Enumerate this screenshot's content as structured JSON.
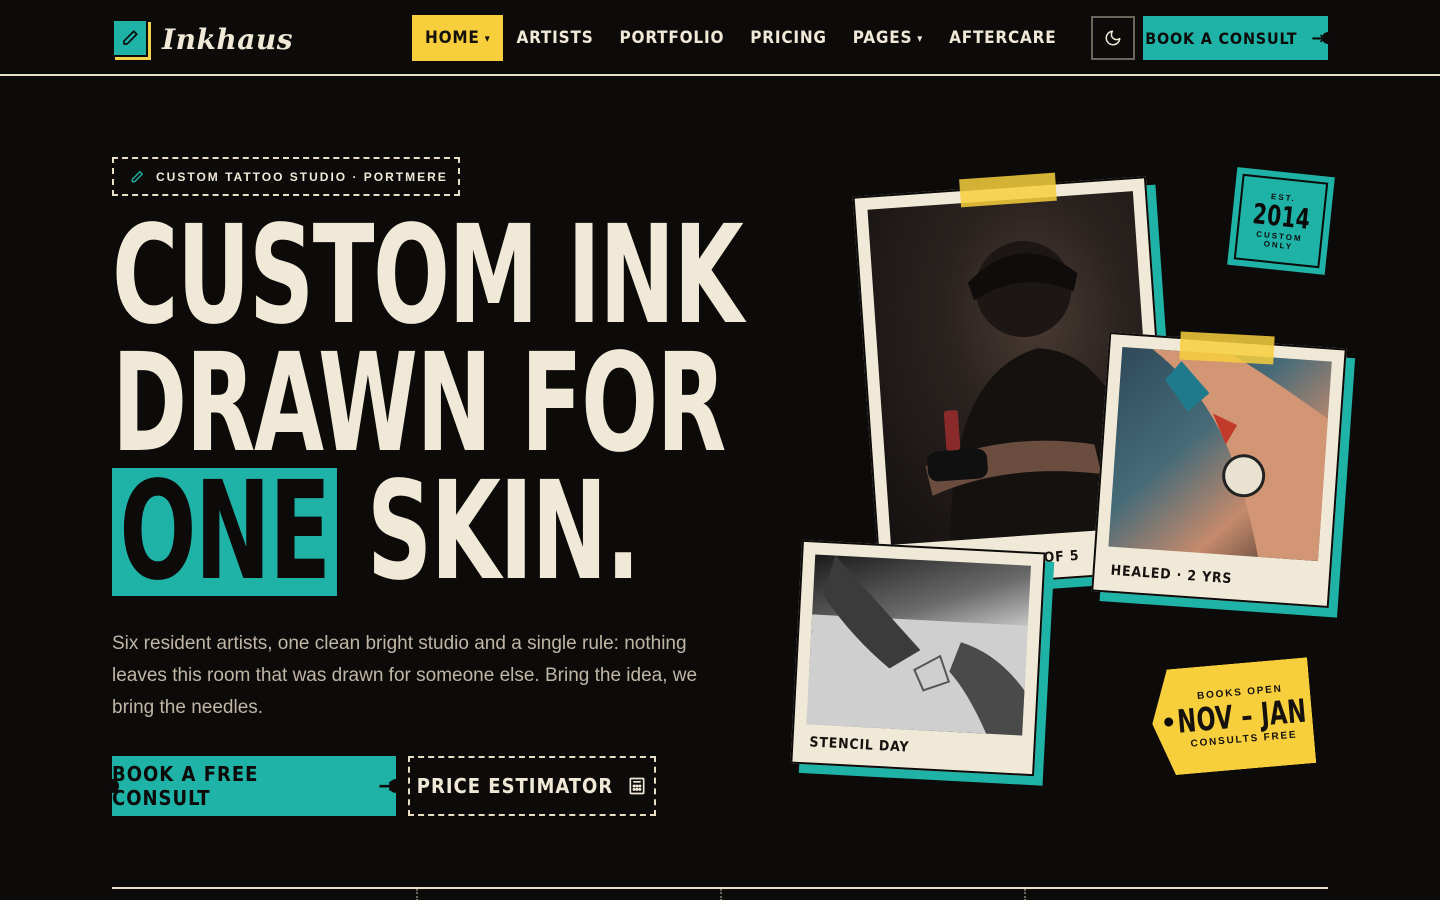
{
  "brand": {
    "name": "Inkhaus"
  },
  "nav": {
    "items": [
      {
        "label": "Home",
        "dropdown": true,
        "active": true
      },
      {
        "label": "Artists",
        "dropdown": false
      },
      {
        "label": "Portfolio",
        "dropdown": false
      },
      {
        "label": "Pricing",
        "dropdown": false
      },
      {
        "label": "Pages",
        "dropdown": true
      },
      {
        "label": "Aftercare",
        "dropdown": false
      }
    ],
    "theme_toggle_icon": "moon-icon",
    "cta_label": "Book a Consult"
  },
  "hero": {
    "tag": "CUSTOM TATTOO STUDIO · PORTMERE",
    "headline": {
      "line1": "Custom Ink",
      "line2": "Drawn For",
      "line3_highlight": "One",
      "line3_rest": "Skin."
    },
    "lead": "Six resident artists, one clean bright studio and a single rule: nothing leaves this room that was drawn for someone else. Bring the idea, we bring the needles.",
    "primary_cta": "Book a Free Consult",
    "secondary_cta": "Price Estimator"
  },
  "gallery": {
    "captions": [
      "Mara · Session 3 of 5",
      "Healed · 2 yrs",
      "Stencil Day"
    ]
  },
  "badges": {
    "est_label": "EST.",
    "est_year": "2014",
    "est_sub1": "CUSTOM",
    "est_sub2": "ONLY",
    "books_top": "BOOKS OPEN",
    "books_range": "NOV – JAN",
    "books_bottom": "CONSULTS FREE"
  },
  "colors": {
    "background": "#0d0b0a",
    "teal": "#1fb2a6",
    "yellow": "#f7cf3c",
    "cream": "#f1e9d8"
  }
}
